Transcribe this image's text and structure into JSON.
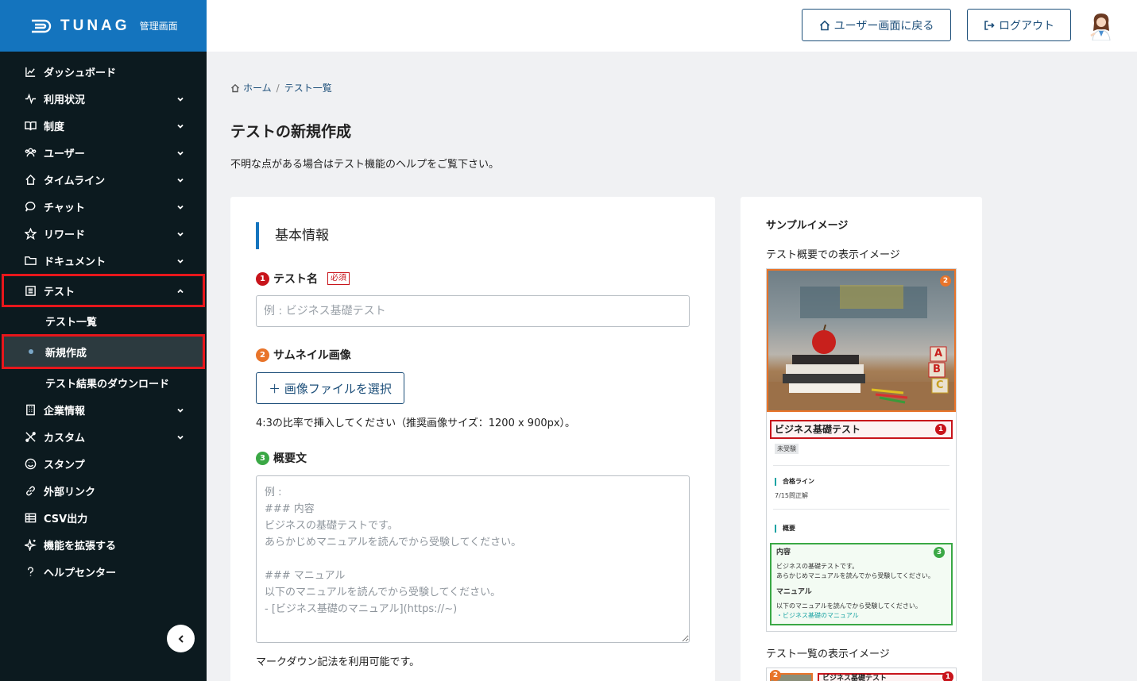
{
  "app": {
    "logo_text": "TUNAG",
    "logo_sub": "管理画面"
  },
  "header": {
    "user_screen_label": "ユーザー画面に戻る",
    "logout_label": "ログアウト"
  },
  "sidebar": {
    "items": [
      {
        "label": "ダッシュボード",
        "icon": "chart-icon"
      },
      {
        "label": "利用状況",
        "icon": "pulse-icon"
      },
      {
        "label": "制度",
        "icon": "book-icon"
      },
      {
        "label": "ユーザー",
        "icon": "users-icon"
      },
      {
        "label": "タイムライン",
        "icon": "home-icon"
      },
      {
        "label": "チャット",
        "icon": "chat-icon"
      },
      {
        "label": "リワード",
        "icon": "star-icon"
      },
      {
        "label": "ドキュメント",
        "icon": "folder-icon"
      },
      {
        "label": "テスト",
        "icon": "list-icon"
      },
      {
        "label": "企業情報",
        "icon": "building-icon"
      },
      {
        "label": "カスタム",
        "icon": "tools-icon"
      },
      {
        "label": "スタンプ",
        "icon": "smile-icon"
      },
      {
        "label": "外部リンク",
        "icon": "link-icon"
      },
      {
        "label": "CSV出力",
        "icon": "table-icon"
      },
      {
        "label": "機能を拡張する",
        "icon": "sparkle-icon"
      },
      {
        "label": "ヘルプセンター",
        "icon": "help-icon"
      }
    ],
    "test_sub": [
      "テスト一覧",
      "新規作成",
      "テスト結果のダウンロード"
    ]
  },
  "breadcrumb": {
    "home": "ホーム",
    "sep": "/",
    "current": "テスト一覧"
  },
  "page": {
    "title": "テストの新規作成",
    "description": "不明な点がある場合はテスト機能のヘルプをご覧下さい。"
  },
  "form": {
    "section": "基本情報",
    "name_label": "テスト名",
    "required": "必須",
    "name_placeholder": "例 : ビジネス基礎テスト",
    "thumb_label": "サムネイル画像",
    "file_button": "＋ 画像ファイルを選択",
    "thumb_hint": "4:3の比率で挿入してください（推奨画像サイズ：1200 x 900px）。",
    "summary_label": "概要文",
    "summary_placeholder": "例 :\n### 内容\nビジネスの基礎テストです。\nあらかじめマニュアルを読んでから受験してください。\n\n### マニュアル\n以下のマニュアルを読んでから受験してください。\n- [ビジネス基礎のマニュアル](https://~)",
    "markdown_hint": "マークダウン記法を利用可能です。",
    "nums": [
      "1",
      "2",
      "3"
    ]
  },
  "sample": {
    "title": "サンプルイメージ",
    "overview_caption": "テスト概要での表示イメージ",
    "list_caption": "テスト一覧の表示イメージ",
    "pv_title": "ビジネス基礎テスト",
    "pv_tag": "未受験",
    "pv_pass_head": "合格ライン",
    "pv_pass_value": "7/15問正解",
    "pv_summary_head": "概要",
    "pv_content_head": "内容",
    "pv_content_1": "ビジネスの基礎テストです。",
    "pv_content_2": "あらかじめマニュアルを読んでから受験してください。",
    "pv_manual_head": "マニュアル",
    "pv_manual_1": "以下のマニュアルを読んでから受験してください。",
    "pv_manual_link": "・ビジネス基礎のマニュアル",
    "blocks": [
      "A",
      "B",
      "C"
    ]
  },
  "colors": {
    "brand": "#1474be",
    "sidebar": "#0c1a1f",
    "highlight": "#e8161b",
    "navy": "#1d4f7a"
  }
}
